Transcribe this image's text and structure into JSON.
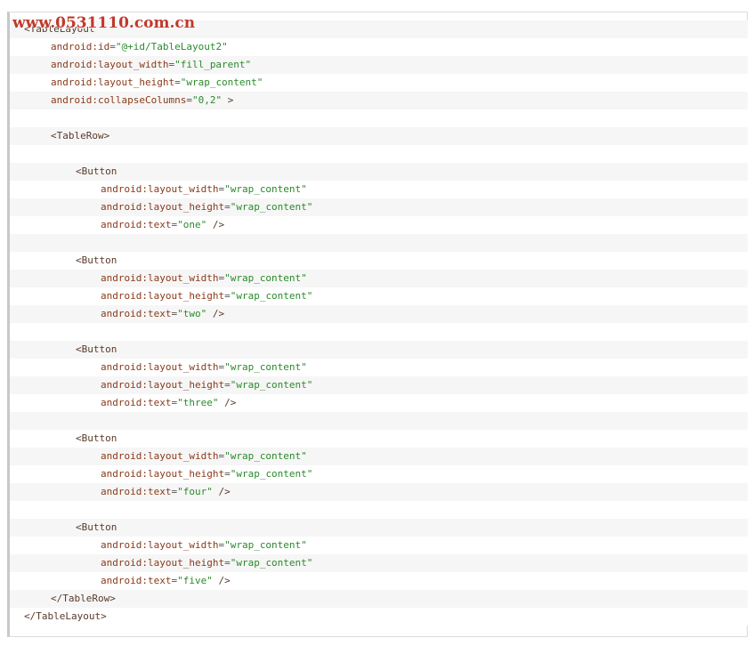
{
  "watermark": "www.0531110.com.cn",
  "lines": [
    {
      "indent": 0,
      "parts": [
        {
          "t": "tag",
          "v": "<TableLayout"
        }
      ]
    },
    {
      "indent": 1,
      "parts": [
        {
          "t": "attr",
          "v": "android:id"
        },
        {
          "t": "eq",
          "v": "="
        },
        {
          "t": "val",
          "v": "\"@+id/TableLayout2\""
        }
      ]
    },
    {
      "indent": 1,
      "parts": [
        {
          "t": "attr",
          "v": "android:layout_width"
        },
        {
          "t": "eq",
          "v": "="
        },
        {
          "t": "val",
          "v": "\"fill_parent\""
        }
      ]
    },
    {
      "indent": 1,
      "parts": [
        {
          "t": "attr",
          "v": "android:layout_height"
        },
        {
          "t": "eq",
          "v": "="
        },
        {
          "t": "val",
          "v": "\"wrap_content\""
        }
      ]
    },
    {
      "indent": 1,
      "parts": [
        {
          "t": "attr",
          "v": "android:collapseColumns"
        },
        {
          "t": "eq",
          "v": "="
        },
        {
          "t": "val",
          "v": "\"0,2\""
        },
        {
          "t": "tag",
          "v": " >"
        }
      ]
    },
    {
      "indent": 0,
      "parts": []
    },
    {
      "indent": 1,
      "parts": [
        {
          "t": "tag",
          "v": "<TableRow>"
        }
      ]
    },
    {
      "indent": 0,
      "parts": []
    },
    {
      "indent": 2,
      "parts": [
        {
          "t": "tag",
          "v": "<Button"
        }
      ]
    },
    {
      "indent": 3,
      "parts": [
        {
          "t": "attr",
          "v": "android:layout_width"
        },
        {
          "t": "eq",
          "v": "="
        },
        {
          "t": "val",
          "v": "\"wrap_content\""
        }
      ]
    },
    {
      "indent": 3,
      "parts": [
        {
          "t": "attr",
          "v": "android:layout_height"
        },
        {
          "t": "eq",
          "v": "="
        },
        {
          "t": "val",
          "v": "\"wrap_content\""
        }
      ]
    },
    {
      "indent": 3,
      "parts": [
        {
          "t": "attr",
          "v": "android:text"
        },
        {
          "t": "eq",
          "v": "="
        },
        {
          "t": "val",
          "v": "\"one\""
        },
        {
          "t": "tag",
          "v": " />"
        }
      ]
    },
    {
      "indent": 0,
      "parts": []
    },
    {
      "indent": 2,
      "parts": [
        {
          "t": "tag",
          "v": "<Button"
        }
      ]
    },
    {
      "indent": 3,
      "parts": [
        {
          "t": "attr",
          "v": "android:layout_width"
        },
        {
          "t": "eq",
          "v": "="
        },
        {
          "t": "val",
          "v": "\"wrap_content\""
        }
      ]
    },
    {
      "indent": 3,
      "parts": [
        {
          "t": "attr",
          "v": "android:layout_height"
        },
        {
          "t": "eq",
          "v": "="
        },
        {
          "t": "val",
          "v": "\"wrap_content\""
        }
      ]
    },
    {
      "indent": 3,
      "parts": [
        {
          "t": "attr",
          "v": "android:text"
        },
        {
          "t": "eq",
          "v": "="
        },
        {
          "t": "val",
          "v": "\"two\""
        },
        {
          "t": "tag",
          "v": " />"
        }
      ]
    },
    {
      "indent": 0,
      "parts": []
    },
    {
      "indent": 2,
      "parts": [
        {
          "t": "tag",
          "v": "<Button"
        }
      ]
    },
    {
      "indent": 3,
      "parts": [
        {
          "t": "attr",
          "v": "android:layout_width"
        },
        {
          "t": "eq",
          "v": "="
        },
        {
          "t": "val",
          "v": "\"wrap_content\""
        }
      ]
    },
    {
      "indent": 3,
      "parts": [
        {
          "t": "attr",
          "v": "android:layout_height"
        },
        {
          "t": "eq",
          "v": "="
        },
        {
          "t": "val",
          "v": "\"wrap_content\""
        }
      ]
    },
    {
      "indent": 3,
      "parts": [
        {
          "t": "attr",
          "v": "android:text"
        },
        {
          "t": "eq",
          "v": "="
        },
        {
          "t": "val",
          "v": "\"three\""
        },
        {
          "t": "tag",
          "v": " />"
        }
      ]
    },
    {
      "indent": 0,
      "parts": []
    },
    {
      "indent": 2,
      "parts": [
        {
          "t": "tag",
          "v": "<Button"
        }
      ]
    },
    {
      "indent": 3,
      "parts": [
        {
          "t": "attr",
          "v": "android:layout_width"
        },
        {
          "t": "eq",
          "v": "="
        },
        {
          "t": "val",
          "v": "\"wrap_content\""
        }
      ]
    },
    {
      "indent": 3,
      "parts": [
        {
          "t": "attr",
          "v": "android:layout_height"
        },
        {
          "t": "eq",
          "v": "="
        },
        {
          "t": "val",
          "v": "\"wrap_content\""
        }
      ]
    },
    {
      "indent": 3,
      "parts": [
        {
          "t": "attr",
          "v": "android:text"
        },
        {
          "t": "eq",
          "v": "="
        },
        {
          "t": "val",
          "v": "\"four\""
        },
        {
          "t": "tag",
          "v": " />"
        }
      ]
    },
    {
      "indent": 0,
      "parts": []
    },
    {
      "indent": 2,
      "parts": [
        {
          "t": "tag",
          "v": "<Button"
        }
      ]
    },
    {
      "indent": 3,
      "parts": [
        {
          "t": "attr",
          "v": "android:layout_width"
        },
        {
          "t": "eq",
          "v": "="
        },
        {
          "t": "val",
          "v": "\"wrap_content\""
        }
      ]
    },
    {
      "indent": 3,
      "parts": [
        {
          "t": "attr",
          "v": "android:layout_height"
        },
        {
          "t": "eq",
          "v": "="
        },
        {
          "t": "val",
          "v": "\"wrap_content\""
        }
      ]
    },
    {
      "indent": 3,
      "parts": [
        {
          "t": "attr",
          "v": "android:text"
        },
        {
          "t": "eq",
          "v": "="
        },
        {
          "t": "val",
          "v": "\"five\""
        },
        {
          "t": "tag",
          "v": " />"
        }
      ]
    },
    {
      "indent": 1,
      "parts": [
        {
          "t": "tag",
          "v": "</TableRow>"
        }
      ]
    },
    {
      "indent": 0,
      "parts": [
        {
          "t": "tag",
          "v": "</TableLayout>"
        }
      ]
    }
  ]
}
